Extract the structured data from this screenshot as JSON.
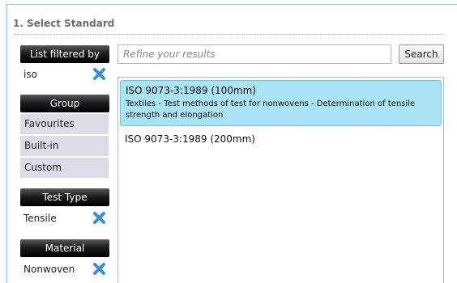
{
  "section": {
    "title": "1. Select Standard"
  },
  "search": {
    "placeholder": "Refine your results",
    "value": "",
    "button_label": "Search"
  },
  "filter": {
    "header": "List filtered by",
    "value": "iso"
  },
  "group": {
    "header": "Group",
    "items": [
      "Favourites",
      "Built-in",
      "Custom"
    ]
  },
  "test_type": {
    "header": "Test Type",
    "value": "Tensile"
  },
  "material": {
    "header": "Material",
    "value": "Nonwoven"
  },
  "results": [
    {
      "title": "ISO 9073-3:1989 (100mm)",
      "description": "Textiles - Test methods of test for nonwovens - Determination of tensile strength and elongation",
      "selected": true
    },
    {
      "title": "ISO 9073-3:1989 (200mm)",
      "description": "",
      "selected": false
    }
  ],
  "colors": {
    "accent": "#a9e3f4",
    "remove_icon": "#3a8fd0",
    "header_dark": "#000000"
  },
  "icons": {
    "remove": "close-x-icon"
  }
}
